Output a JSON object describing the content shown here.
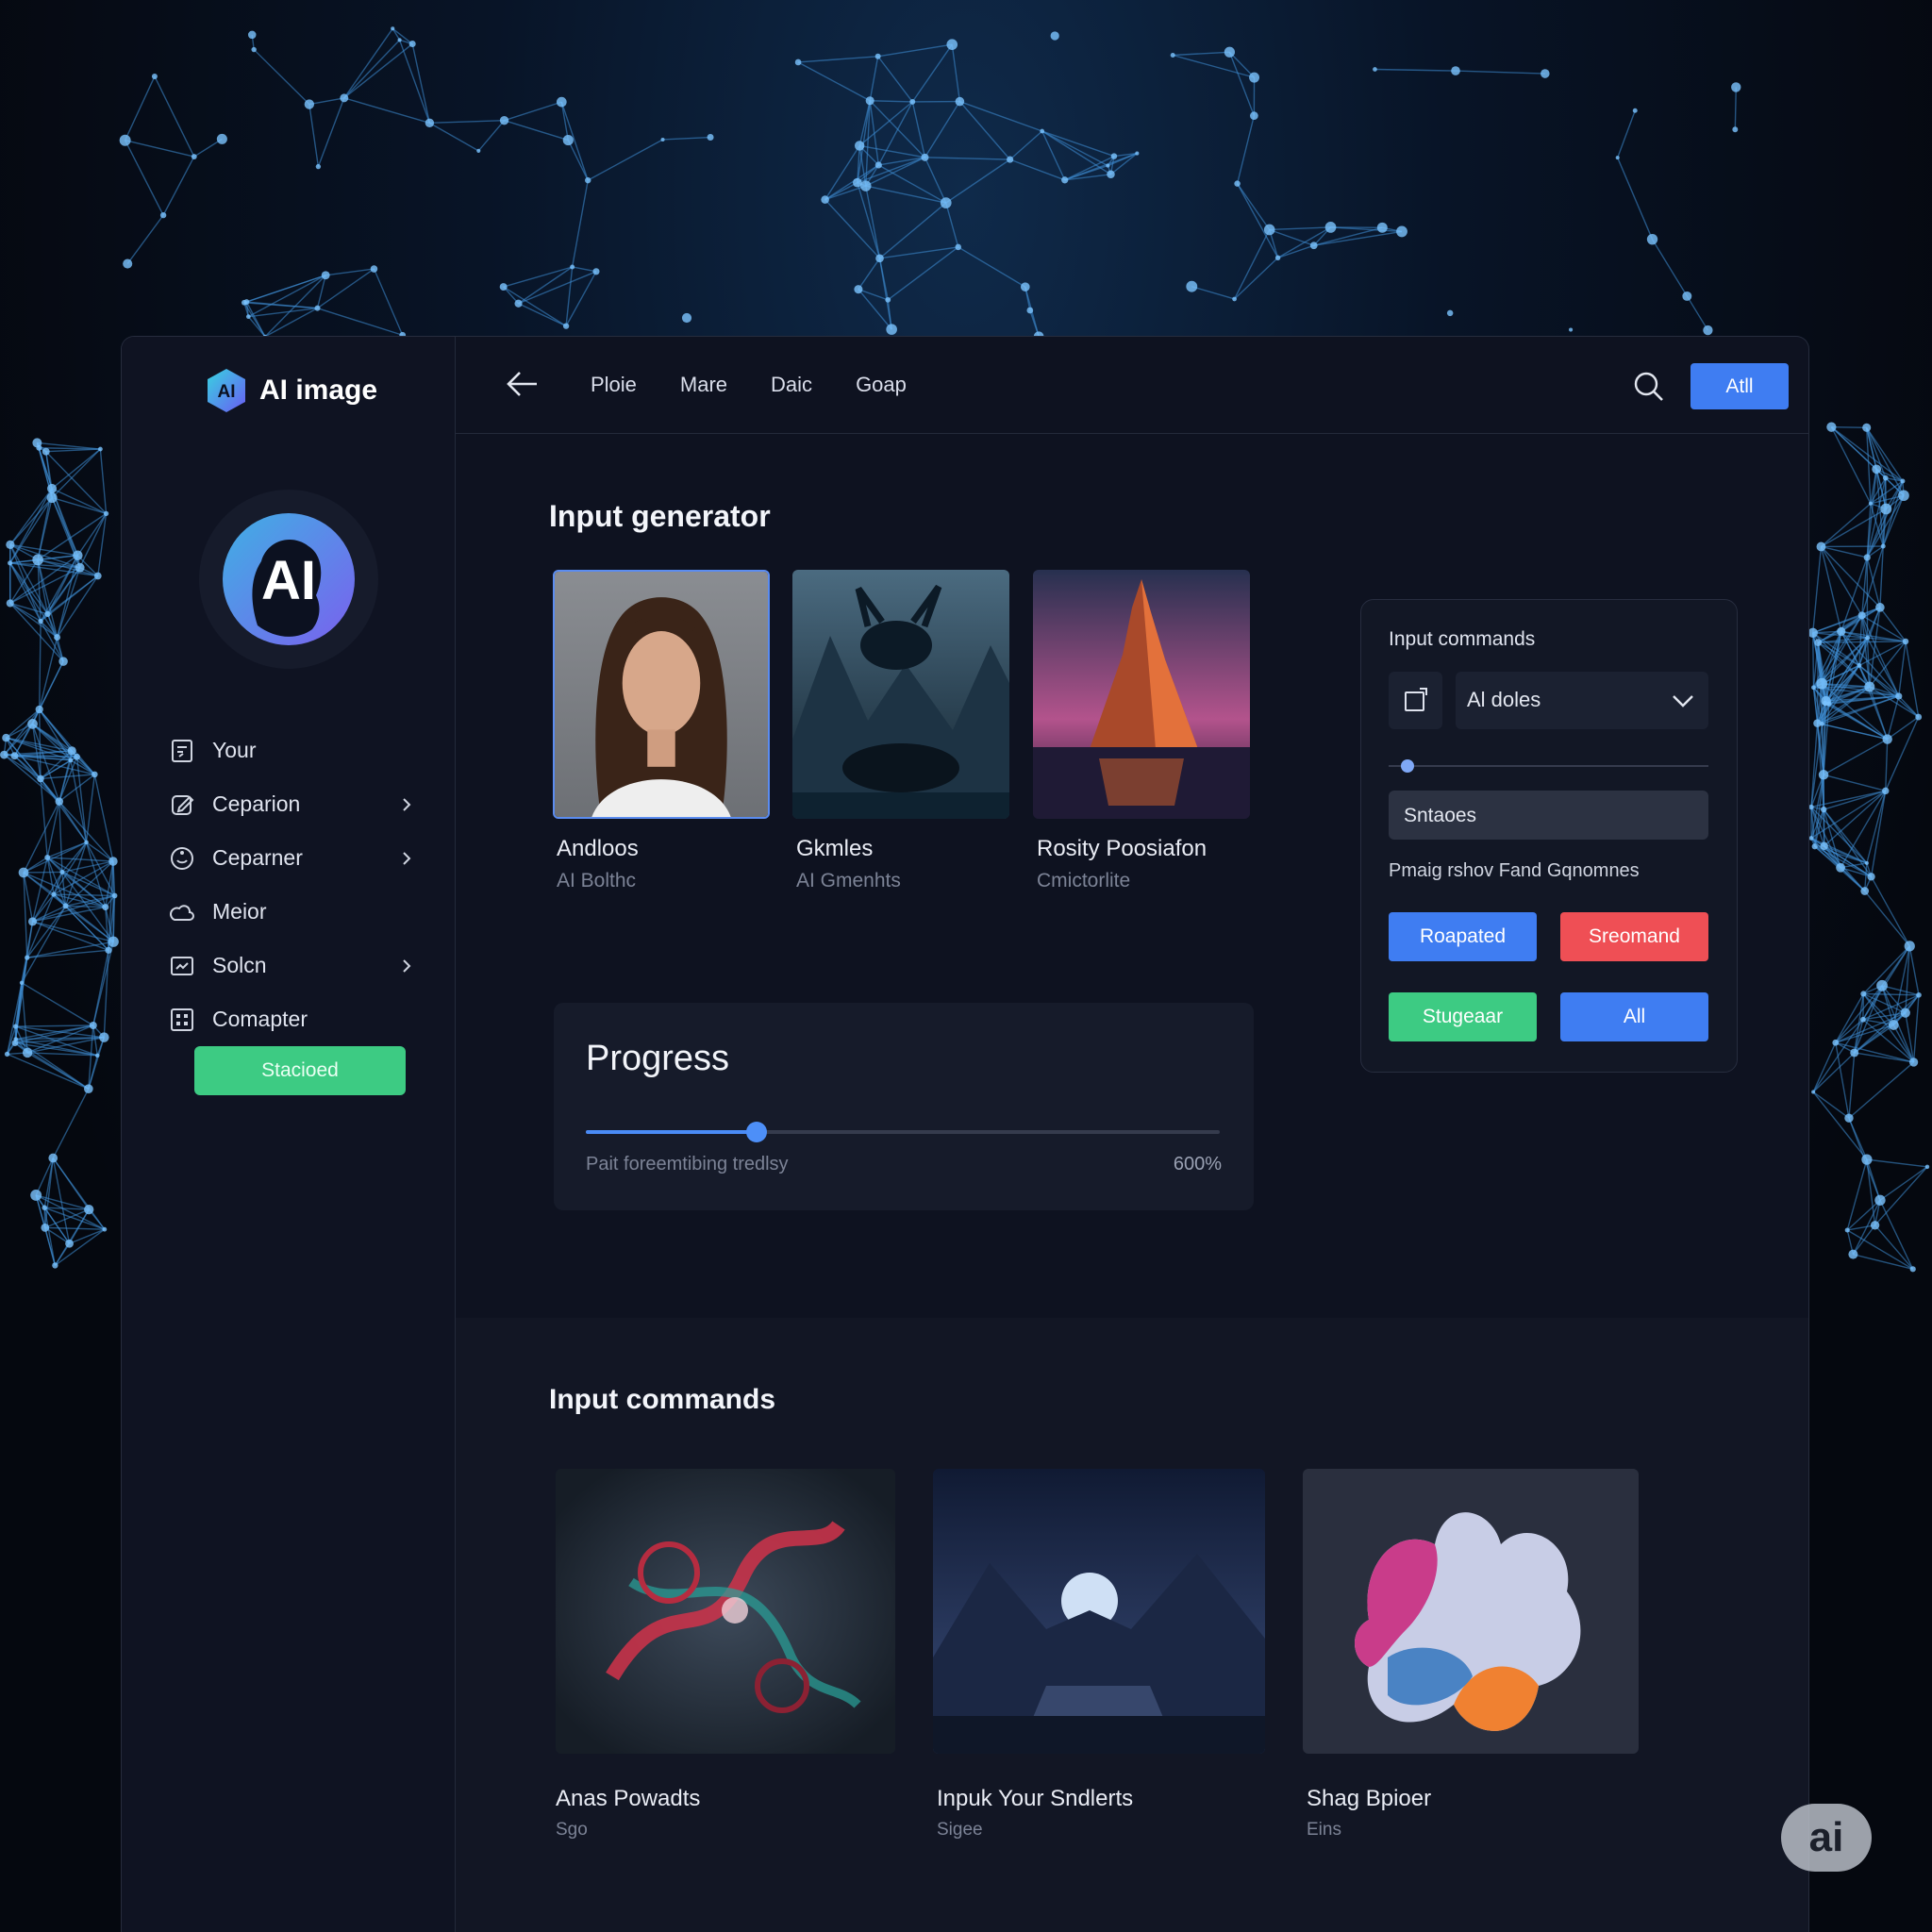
{
  "app": {
    "brand_name": "AI image",
    "brand_mark": "AI",
    "avatar_text": "AI"
  },
  "sidebar": {
    "items": [
      {
        "label": "Your",
        "icon": "document-icon",
        "has_chevron": false
      },
      {
        "label": "Ceparion",
        "icon": "edit-icon",
        "has_chevron": true
      },
      {
        "label": "Ceparner",
        "icon": "face-icon",
        "has_chevron": true
      },
      {
        "label": "Meior",
        "icon": "cloud-icon",
        "has_chevron": false
      },
      {
        "label": "Solcn",
        "icon": "media-icon",
        "has_chevron": true
      },
      {
        "label": "Comapter",
        "icon": "grid-icon",
        "has_chevron": false
      }
    ],
    "button_label": "Stacioed"
  },
  "topbar": {
    "tabs": [
      "Ploie",
      "Mare",
      "Daic",
      "Goap"
    ],
    "button_label": "Atll"
  },
  "generator": {
    "title": "Input generator",
    "cards": [
      {
        "title": "Andloos",
        "subtitle": "AI Bolthc",
        "selected": true
      },
      {
        "title": "Gkmles",
        "subtitle": "AI Gmenhts",
        "selected": false
      },
      {
        "title": "Rosity Poosiafon",
        "subtitle": "Cmictorlite",
        "selected": false
      }
    ]
  },
  "progress": {
    "title": "Progress",
    "caption": "Pait foreemtibing tredlsy",
    "value_label": "600%",
    "fill_fraction": 0.27
  },
  "commands": {
    "title": "Input commands",
    "select_value": "Al doles",
    "slider_fraction": 0.06,
    "input_value": "Sntaoes",
    "description": "Pmaig rshov Fand Gqnomnes",
    "buttons": [
      {
        "label": "Roapated",
        "color": "#3f7df2"
      },
      {
        "label": "Sreomand",
        "color": "#ef4f55"
      },
      {
        "label": "Stugeaar",
        "color": "#3dcb83"
      },
      {
        "label": "All",
        "color": "#3f7df2"
      }
    ]
  },
  "lower": {
    "title": "Input commands",
    "cards": [
      {
        "title": "Anas Powadts",
        "subtitle": "Sgo"
      },
      {
        "title": "Inpuk Your Sndlerts",
        "subtitle": "Sigee"
      },
      {
        "title": "Shag Bpioer",
        "subtitle": "Eins"
      }
    ]
  },
  "badge_label": "ai",
  "colors": {
    "accent_blue": "#3f7df2",
    "accent_green": "#3dcb83",
    "accent_red": "#ef4f55",
    "background": "#0e1220"
  }
}
